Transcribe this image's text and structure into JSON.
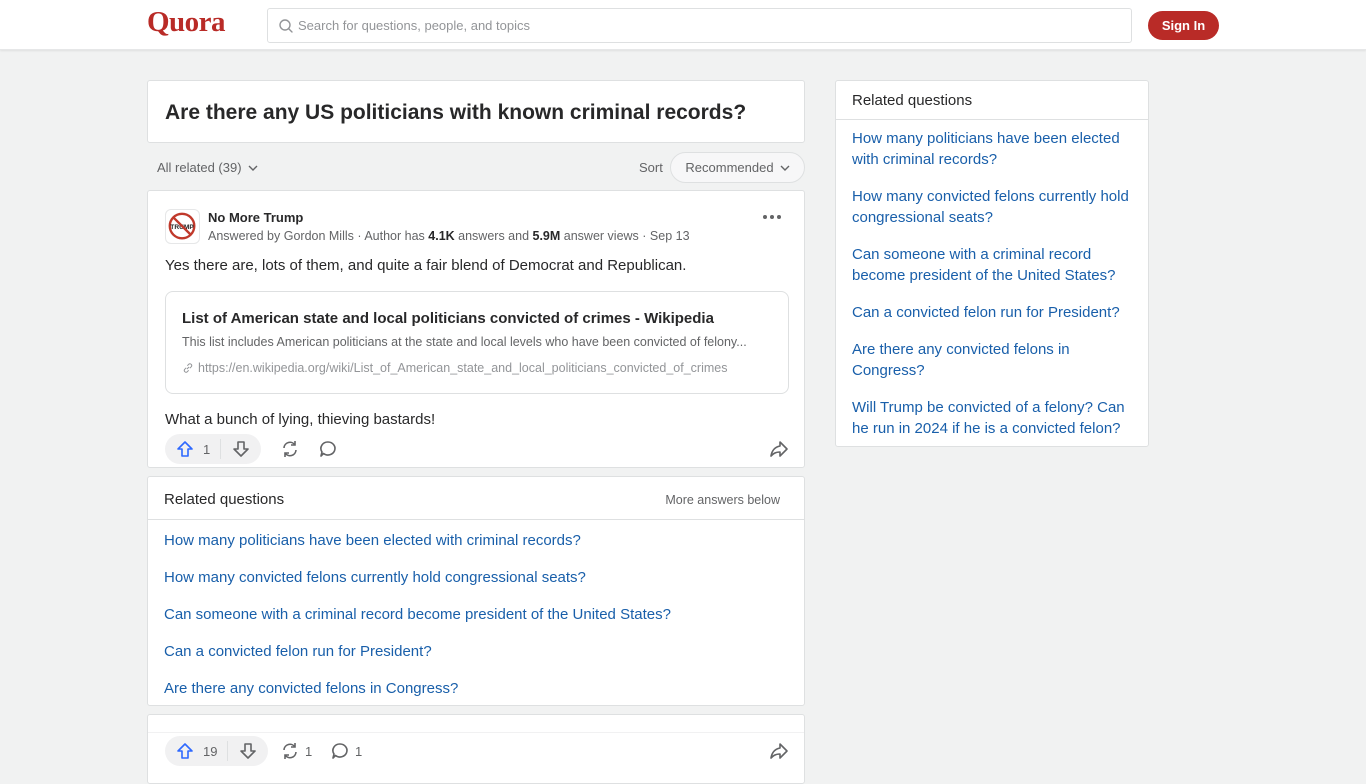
{
  "header": {
    "logo": "Quora",
    "search_placeholder": "Search for questions, people, and topics",
    "signin_label": "Sign In"
  },
  "question": {
    "title": "Are there any US politicians with known criminal records?"
  },
  "filters": {
    "all_related_label": "All related (39)",
    "sort_label": "Sort",
    "sort_value": "Recommended"
  },
  "answer": {
    "author_name": "No More Trump",
    "avatar_text": "TRUMP",
    "meta_prefix": "Answered by Gordon Mills",
    "meta_sep1": " · Author has ",
    "answers_count": "4.1K",
    "meta_mid": " answers and ",
    "views_count": "5.9M",
    "meta_suffix": " answer views · Sep 13",
    "text1": "Yes there are, lots of them, and quite a fair blend of Democrat and Republican.",
    "link": {
      "title": "List of American state and local politicians convicted of crimes - Wikipedia",
      "description": "This list includes American politicians at the state and local levels who have been convicted of felony...",
      "url": "https://en.wikipedia.org/wiki/List_of_American_state_and_local_politicians_convicted_of_crimes"
    },
    "text2": "What a bunch of lying, thieving bastards!",
    "upvotes": "1"
  },
  "related_inline": {
    "title": "Related questions",
    "more_label": "More answers below",
    "items": [
      "How many politicians have been elected with criminal records?",
      "How many convicted felons currently hold congressional seats?",
      "Can someone with a criminal record become president of the United States?",
      "Can a convicted felon run for President?",
      "Are there any convicted felons in Congress?"
    ]
  },
  "answer2": {
    "upvotes": "19",
    "shares": "1",
    "comments": "1"
  },
  "sidebar": {
    "title": "Related questions",
    "items": [
      "How many politicians have been elected with criminal records?",
      "How many convicted felons currently hold congressional seats?",
      "Can someone with a criminal record become president of the United States?",
      "Can a convicted felon run for President?",
      "Are there any convicted felons in Congress?",
      "Will Trump be convicted of a felony? Can he run in 2024 if he is a convicted felon?"
    ]
  },
  "colors": {
    "brand": "#b92b27",
    "link": "#195faa",
    "upvote": "#2e69ff"
  }
}
